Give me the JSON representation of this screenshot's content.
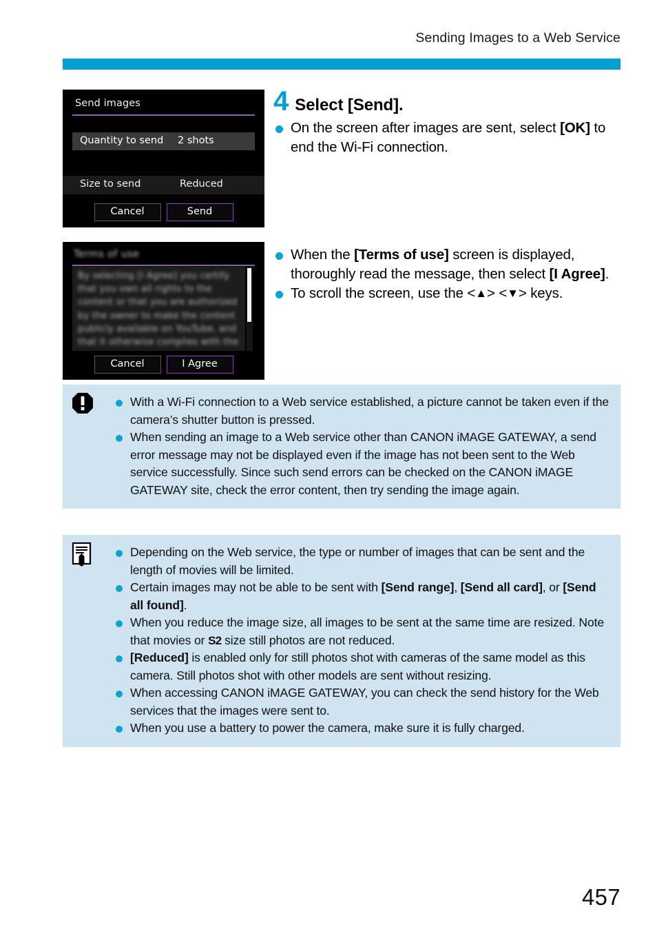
{
  "header": {
    "running_title": "Sending Images to a Web Service"
  },
  "theme": {
    "accent": "#00a0d2",
    "bullet": "#00a6d6",
    "tint_background": "#cfe3f0",
    "lcd_selection": "#9b30d0"
  },
  "step": {
    "number": "4",
    "title": "Select [Send].",
    "bullets_top": [
      "On the screen after images are sent, select [OK] to end the Wi-Fi connection."
    ],
    "bullets_bottom": [
      "When the [Terms of use] screen is displayed, thoroughly read the message, then select [I Agree].",
      "To scroll the screen, use the <▲> <▼> keys."
    ]
  },
  "lcd_send_images": {
    "title": "Send images",
    "row_highlight": {
      "label": "Quantity to send",
      "value": "2 shots"
    },
    "row_plain": {
      "label": "Size to send",
      "value": "Reduced"
    },
    "buttons": [
      {
        "label": "Cancel",
        "selected": false
      },
      {
        "label": "Send",
        "selected": true
      }
    ]
  },
  "lcd_terms_of_use": {
    "title": "Terms of use",
    "body": "By selecting [I Agree] you certify that you own all rights to the content or that you are authorized by the owner to make the content publicly available on YouTube, and that it otherwise complies with the",
    "buttons": [
      {
        "label": "Cancel",
        "selected": false
      },
      {
        "label": "I Agree",
        "selected": true
      }
    ]
  },
  "warning_box": {
    "icon": "warning-octagon-icon",
    "items": [
      "With a Wi-Fi connection to a Web service established, a picture cannot be taken even if the camera’s shutter button is pressed.",
      "When sending an image to a Web service other than CANON iMAGE GATEWAY, a send error message may not be displayed even if the image has not been sent to the Web service successfully. Since such send errors can be checked on the CANON iMAGE GATEWAY site, check the error content, then try sending the image again."
    ]
  },
  "note_box": {
    "icon": "note-pencil-icon",
    "items": [
      "Depending on the Web service, the type or number of images that can be sent and the length of movies will be limited.",
      "Certain images may not be able to be sent with [Send range], [Send all card], or [Send all found].",
      "When you reduce the image size, all images to be sent at the same time are resized. Note that movies or S2 size still photos are not reduced.",
      "[Reduced] is enabled only for still photos shot with cameras of the same model as this camera. Still photos shot with other models are sent without resizing.",
      "When accessing CANON iMAGE GATEWAY, you can check the send history for the Web services that the images were sent to.",
      "When you use a battery to power the camera, make sure it is fully charged."
    ]
  },
  "footer": {
    "page_number": "457"
  }
}
